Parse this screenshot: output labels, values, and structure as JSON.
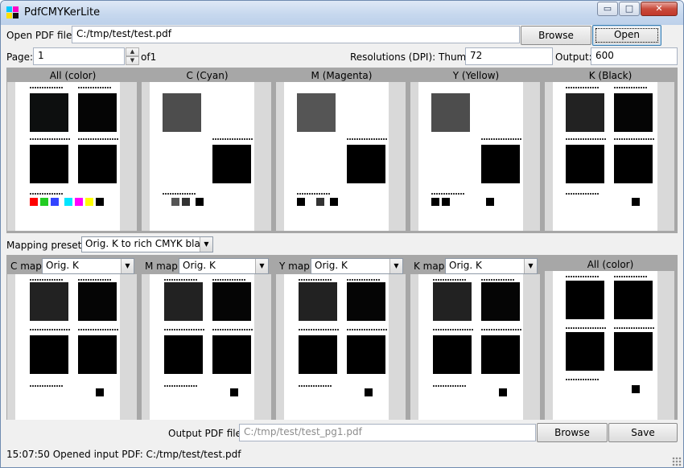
{
  "window": {
    "title": "PdfCMYKerLite"
  },
  "titlebar_buttons": {
    "minimize": "▭",
    "maximize": "□",
    "close": "✕"
  },
  "open": {
    "label": "Open PDF file:",
    "path": "C:/tmp/test/test.pdf",
    "browse_label": "Browse",
    "open_label": "Open"
  },
  "page": {
    "label": "Page:",
    "value": "1",
    "of_label": "of1"
  },
  "resolution": {
    "label": "Resolutions (DPI): Thumb:",
    "thumb_value": "72",
    "output_label": "Output:",
    "output_value": "600"
  },
  "separations": {
    "titles": [
      "All (color)",
      "C (Cyan)",
      "M (Magenta)",
      "Y (Yellow)",
      "K (Black)"
    ]
  },
  "mapping": {
    "preset_label": "Mapping preset:",
    "preset_value": "Orig. K to rich CMYK black",
    "maps": [
      {
        "label": "C map:",
        "value": "Orig. K"
      },
      {
        "label": "M map:",
        "value": "Orig. K"
      },
      {
        "label": "Y map:",
        "value": "Orig. K"
      },
      {
        "label": "K map:",
        "value": "Orig. K"
      }
    ],
    "result_title": "All (color)"
  },
  "output": {
    "label": "Output PDF file:",
    "placeholder": "C:/tmp/test/test_pg1.pdf",
    "browse_label": "Browse",
    "save_label": "Save"
  },
  "status": {
    "text": "15:07:50 Opened input PDF: C:/tmp/test/test.pdf"
  },
  "icons": {
    "spin_up": "▲",
    "spin_down": "▼",
    "dropdown": "▼"
  },
  "colors": {
    "title_grad_top": "#dfe9f6",
    "preview_bg": "#a7a7a7",
    "swatches": [
      "#ff0000",
      "#22cc22",
      "#3344ff",
      "#00e5ff",
      "#ff00ff",
      "#ffff00",
      "#000000"
    ]
  }
}
